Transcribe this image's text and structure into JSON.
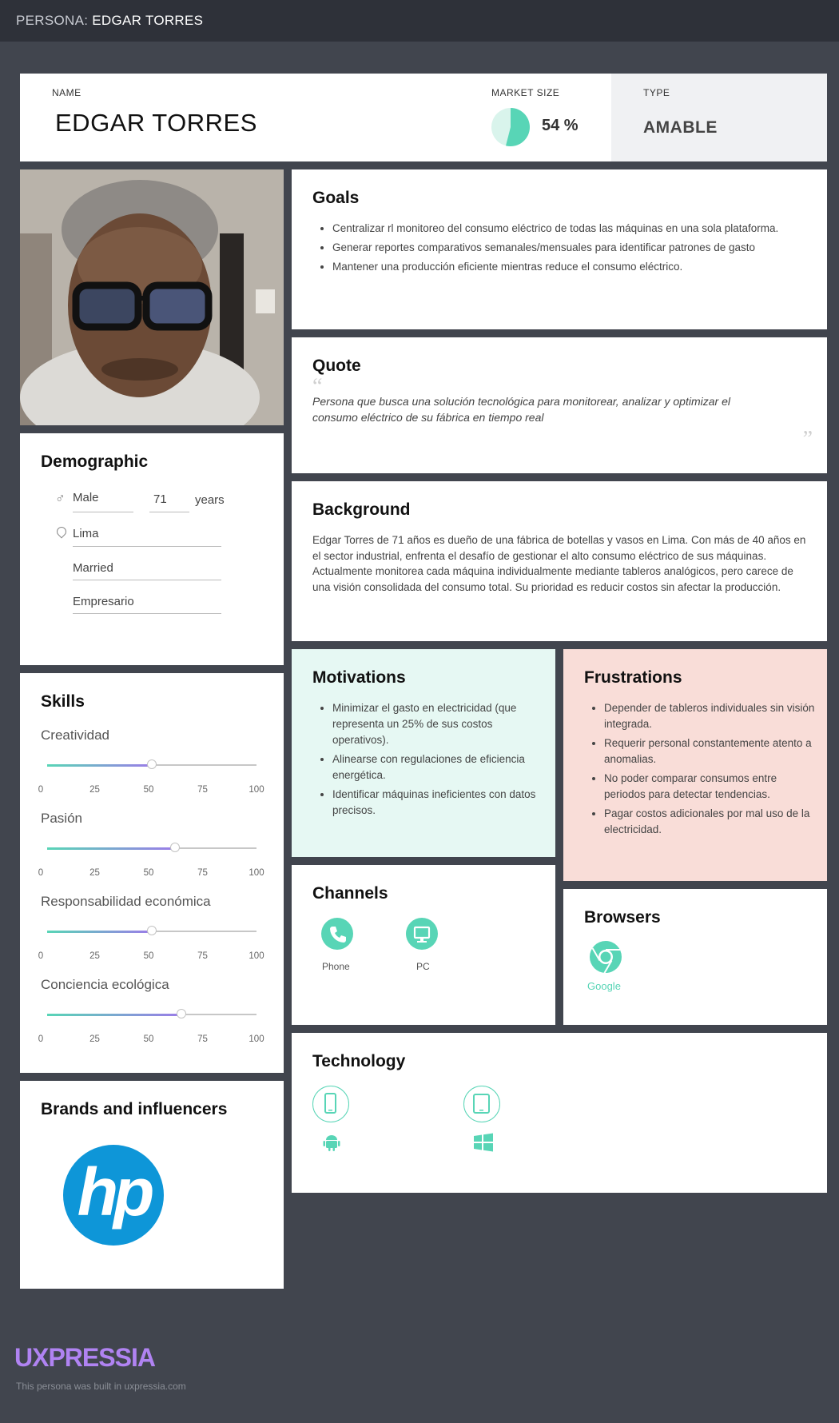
{
  "header": {
    "prefix": "PERSONA: ",
    "name": "EDGAR TORRES"
  },
  "colors": {
    "accent": "#58d5b6",
    "purple": "#9b7ce8",
    "background": "#41454e",
    "topbar": "#2e3139",
    "motivations_bg": "#e6f8f3",
    "frustrations_bg": "#f9ddd8"
  },
  "profile": {
    "name_label": "NAME",
    "name": "EDGAR TORRES",
    "market_label": "MARKET SIZE",
    "market_value": "54 %",
    "market_fraction": 0.54,
    "type_label": "TYPE",
    "type_value": "AMABLE"
  },
  "goals": {
    "title": "Goals",
    "items": [
      "Centralizar rl monitoreo del consumo eléctrico de todas las máquinas en una sola plataforma.",
      "Generar reportes comparativos semanales/mensuales para identificar patrones de gasto",
      "Mantener una producción eficiente mientras reduce el consumo eléctrico."
    ]
  },
  "quote": {
    "title": "Quote",
    "text": "Persona que busca una solución tecnológica para monitorear, analizar y optimizar el consumo eléctrico de su fábrica en tiempo real"
  },
  "background": {
    "title": "Background",
    "text": "Edgar Torres de 71 años es dueño de una fábrica de botellas y vasos en Lima. Con más de 40 años en el sector industrial, enfrenta el desafío de gestionar el alto consumo eléctrico de sus máquinas. Actualmente monitorea cada máquina individualmente mediante tableros analógicos, pero carece de una visión consolidada del consumo total. Su prioridad es reducir costos sin afectar la producción."
  },
  "demographic": {
    "title": "Demographic",
    "gender": "Male",
    "age": "71",
    "age_unit": "years",
    "location": "Lima",
    "status": "Married",
    "occupation": "Empresario"
  },
  "skills": {
    "title": "Skills",
    "ticks": [
      "0",
      "25",
      "50",
      "75",
      "100"
    ],
    "items": [
      {
        "label": "Creatividad",
        "value": 50
      },
      {
        "label": "Pasión",
        "value": 61
      },
      {
        "label": "Responsabilidad económica",
        "value": 50
      },
      {
        "label": "Conciencia ecológica",
        "value": 64
      }
    ]
  },
  "motivations": {
    "title": "Motivations",
    "items": [
      "Minimizar el gasto en electricidad (que representa un 25% de sus costos operativos).",
      "Alinearse con regulaciones de eficiencia energética.",
      "Identificar máquinas ineficientes con datos precisos."
    ]
  },
  "frustrations": {
    "title": "Frustrations",
    "items": [
      "Depender de tableros individuales sin visión integrada.",
      "Requerir personal constantemente atento a anomalias.",
      "No poder comparar consumos entre periodos para detectar tendencias.",
      "Pagar costos adicionales por mal uso de la electricidad."
    ]
  },
  "channels": {
    "title": "Channels",
    "items": [
      {
        "label": "Phone",
        "icon": "phone-icon"
      },
      {
        "label": "PC",
        "icon": "monitor-icon"
      }
    ]
  },
  "browsers": {
    "title": "Browsers",
    "items": [
      {
        "label": "Google",
        "icon": "chrome-icon"
      }
    ]
  },
  "technology": {
    "title": "Technology",
    "items": [
      {
        "device_icon": "smartphone-icon",
        "os_icon": "android-icon"
      },
      {
        "device_icon": "tablet-icon",
        "os_icon": "windows-icon"
      }
    ]
  },
  "brands": {
    "title": "Brands and influencers",
    "logo_text": "hp"
  },
  "footer": {
    "brand": "UXPRESSIA",
    "note": "This persona was built in uxpressia.com"
  }
}
